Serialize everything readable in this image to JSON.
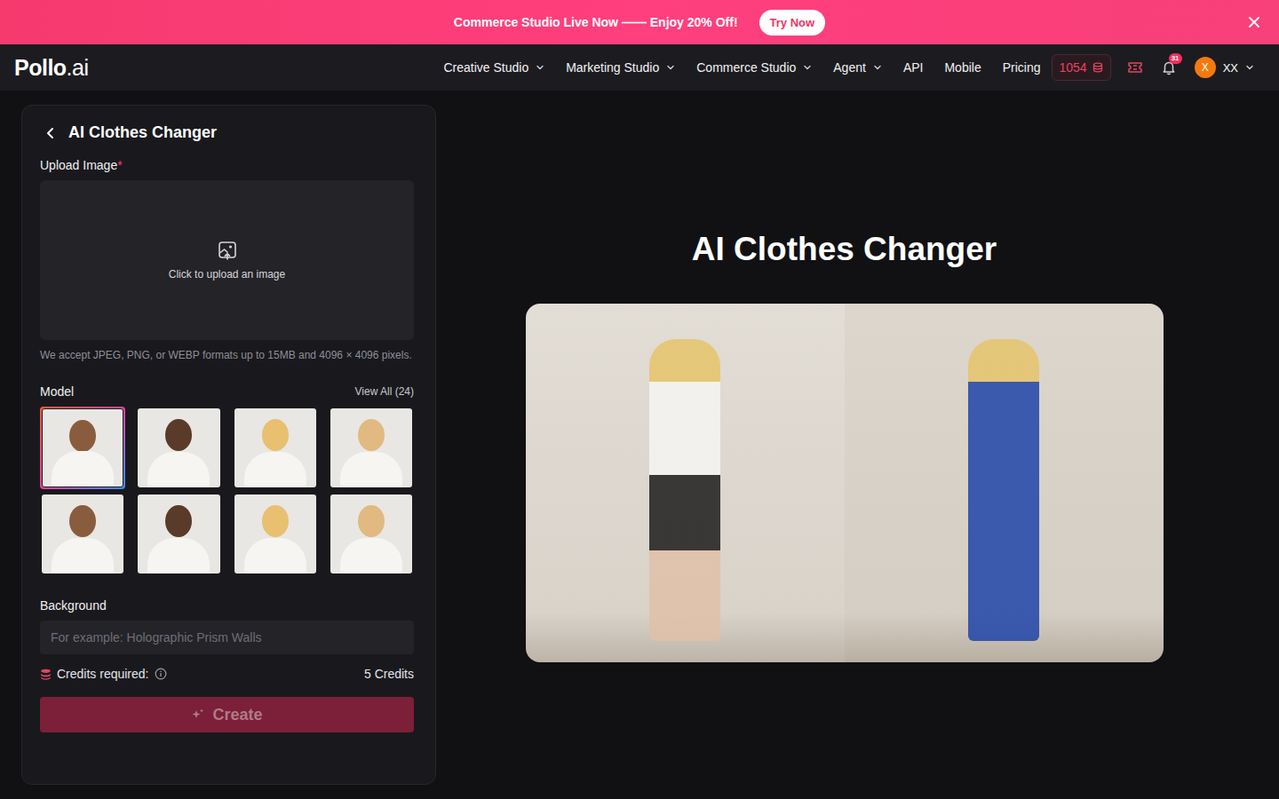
{
  "banner": {
    "text": "Commerce Studio Live Now —— Enjoy 20% Off!",
    "button": "Try Now"
  },
  "nav": {
    "logo": {
      "main": "Pollo",
      "suffix": ".ai"
    },
    "items": [
      {
        "label": "Creative Studio",
        "dropdown": true
      },
      {
        "label": "Marketing Studio",
        "dropdown": true
      },
      {
        "label": "Commerce Studio",
        "dropdown": true
      },
      {
        "label": "Agent",
        "dropdown": true
      },
      {
        "label": "API",
        "dropdown": false
      },
      {
        "label": "Mobile",
        "dropdown": false
      },
      {
        "label": "Pricing",
        "dropdown": false
      }
    ],
    "credits": "1054",
    "notifications": "31",
    "avatar": "X",
    "user": "XX"
  },
  "panel": {
    "title": "AI Clothes Changer",
    "upload": {
      "label": "Upload Image",
      "required_mark": "*",
      "prompt": "Click to upload an image",
      "note": "We accept JPEG, PNG, or WEBP formats up to 15MB and 4096 × 4096 pixels."
    },
    "model": {
      "label": "Model",
      "view_all": "View All (24)",
      "models": [
        {
          "selected": true
        },
        {
          "selected": false
        },
        {
          "selected": false
        },
        {
          "selected": false
        },
        {
          "selected": false
        },
        {
          "selected": false
        },
        {
          "selected": false
        },
        {
          "selected": false
        }
      ]
    },
    "background": {
      "label": "Background",
      "placeholder": "For example: Holographic Prism Walls"
    },
    "credits": {
      "label": "Credits required:",
      "value": "5 Credits"
    },
    "create": {
      "label": "Create",
      "disabled": true
    }
  },
  "hero": {
    "title": "AI Clothes Changer"
  }
}
